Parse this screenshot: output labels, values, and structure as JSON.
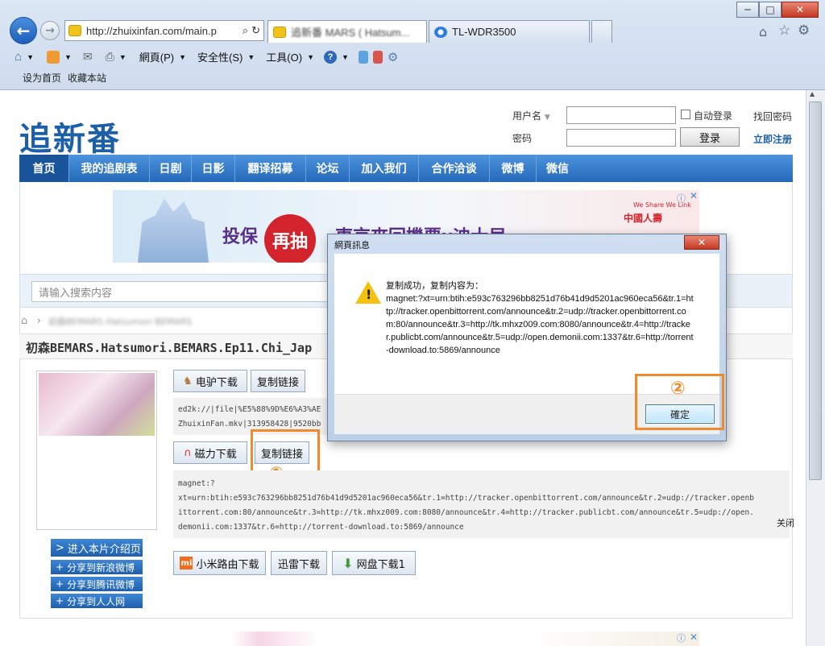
{
  "browser": {
    "url": "http://zhuixinfan.com/main.p",
    "tabs": [
      {
        "label": "追新番 MARS ( Hatsum..."
      },
      {
        "label": "TL-WDR3500"
      }
    ],
    "window_buttons": {
      "minimize": "─",
      "maximize": "□",
      "close": "✕"
    },
    "toolbar": {
      "page": "網頁(P)",
      "safety": "安全性(S)",
      "tools": "工具(O)",
      "help": "?"
    }
  },
  "site": {
    "top_links": [
      "设为首页",
      "收藏本站"
    ],
    "logo": "追新番",
    "login": {
      "username_label": "用户名",
      "password_label": "密码",
      "auto_login": "自动登录",
      "login_button": "登录",
      "forgot": "找回密码",
      "register": "立即注册"
    },
    "nav": [
      "首页",
      "我的追剧表",
      "日剧",
      "日影",
      "翻译招募",
      "论坛",
      "加入我们",
      "合作洽谈",
      "微博",
      "微信"
    ],
    "banner": {
      "text_left": "投保",
      "text_circle": "再抽",
      "text_right": "東京來回機票x迪士尼",
      "brand": "中國人壽",
      "slogan": "We Share We Link"
    },
    "search_placeholder": "请输入搜索内容",
    "breadcrumb": "初森BEMARS Hatsumori BEMARS",
    "title": "初森BEMARS.Hatsumori.BEMARS.Ep11.Chi_Jap",
    "buttons": {
      "ed2k_download": "电驴下载",
      "copy_link": "复制链接",
      "magnet_download": "磁力下载",
      "copy_link_2": "复制链接",
      "xiaomi": "小米路由下载",
      "xunlei": "迅雷下载",
      "netdisk": "网盘下载1"
    },
    "ed2k_text": "ed2k://|file|%E5%88%9D%E6%A3%AE\nZhuixinFan.mkv|313958428|9520bb",
    "magnet_text": "magnet:?\nxt=urn:btih:e593c763296bb8251d76b41d9d5201ac960eca56&tr.1=http://tracker.openbittorrent.com/announce&tr.2=udp://tracker.openb\nittorrent.com:80/announce&tr.3=http://tk.mhxz009.com:8080/announce&tr.4=http://tracker.publicbt.com/announce&tr.5=udp://open.\ndemonii.com:1337&tr.6=http://torrent-download.to:5869/announce",
    "close_label": "关闭",
    "side_buttons": [
      "进入本片介绍页",
      "分享到新浪微博",
      "分享到腾讯微博",
      "分享到人人网"
    ],
    "side_prefixes": [
      ">",
      "+",
      "+",
      "+"
    ]
  },
  "annotations": {
    "step1": "①",
    "step2": "②"
  },
  "dialog": {
    "title": "網頁訊息",
    "message": "复制成功，复制内容为：\nmagnet:?xt=urn:btih:e593c763296bb8251d76b41d9d5201ac960eca56&tr.1=http://tracker.openbittorrent.com/announce&tr.2=udp://tracker.openbittorrent.com:80/announce&tr.3=http://tk.mhxz009.com:8080/announce&tr.4=http://tracker.publicbt.com/announce&tr.5=udp://open.demonii.com:1337&tr.6=http://torrent-download.to:5869/announce",
    "ok": "確定"
  }
}
